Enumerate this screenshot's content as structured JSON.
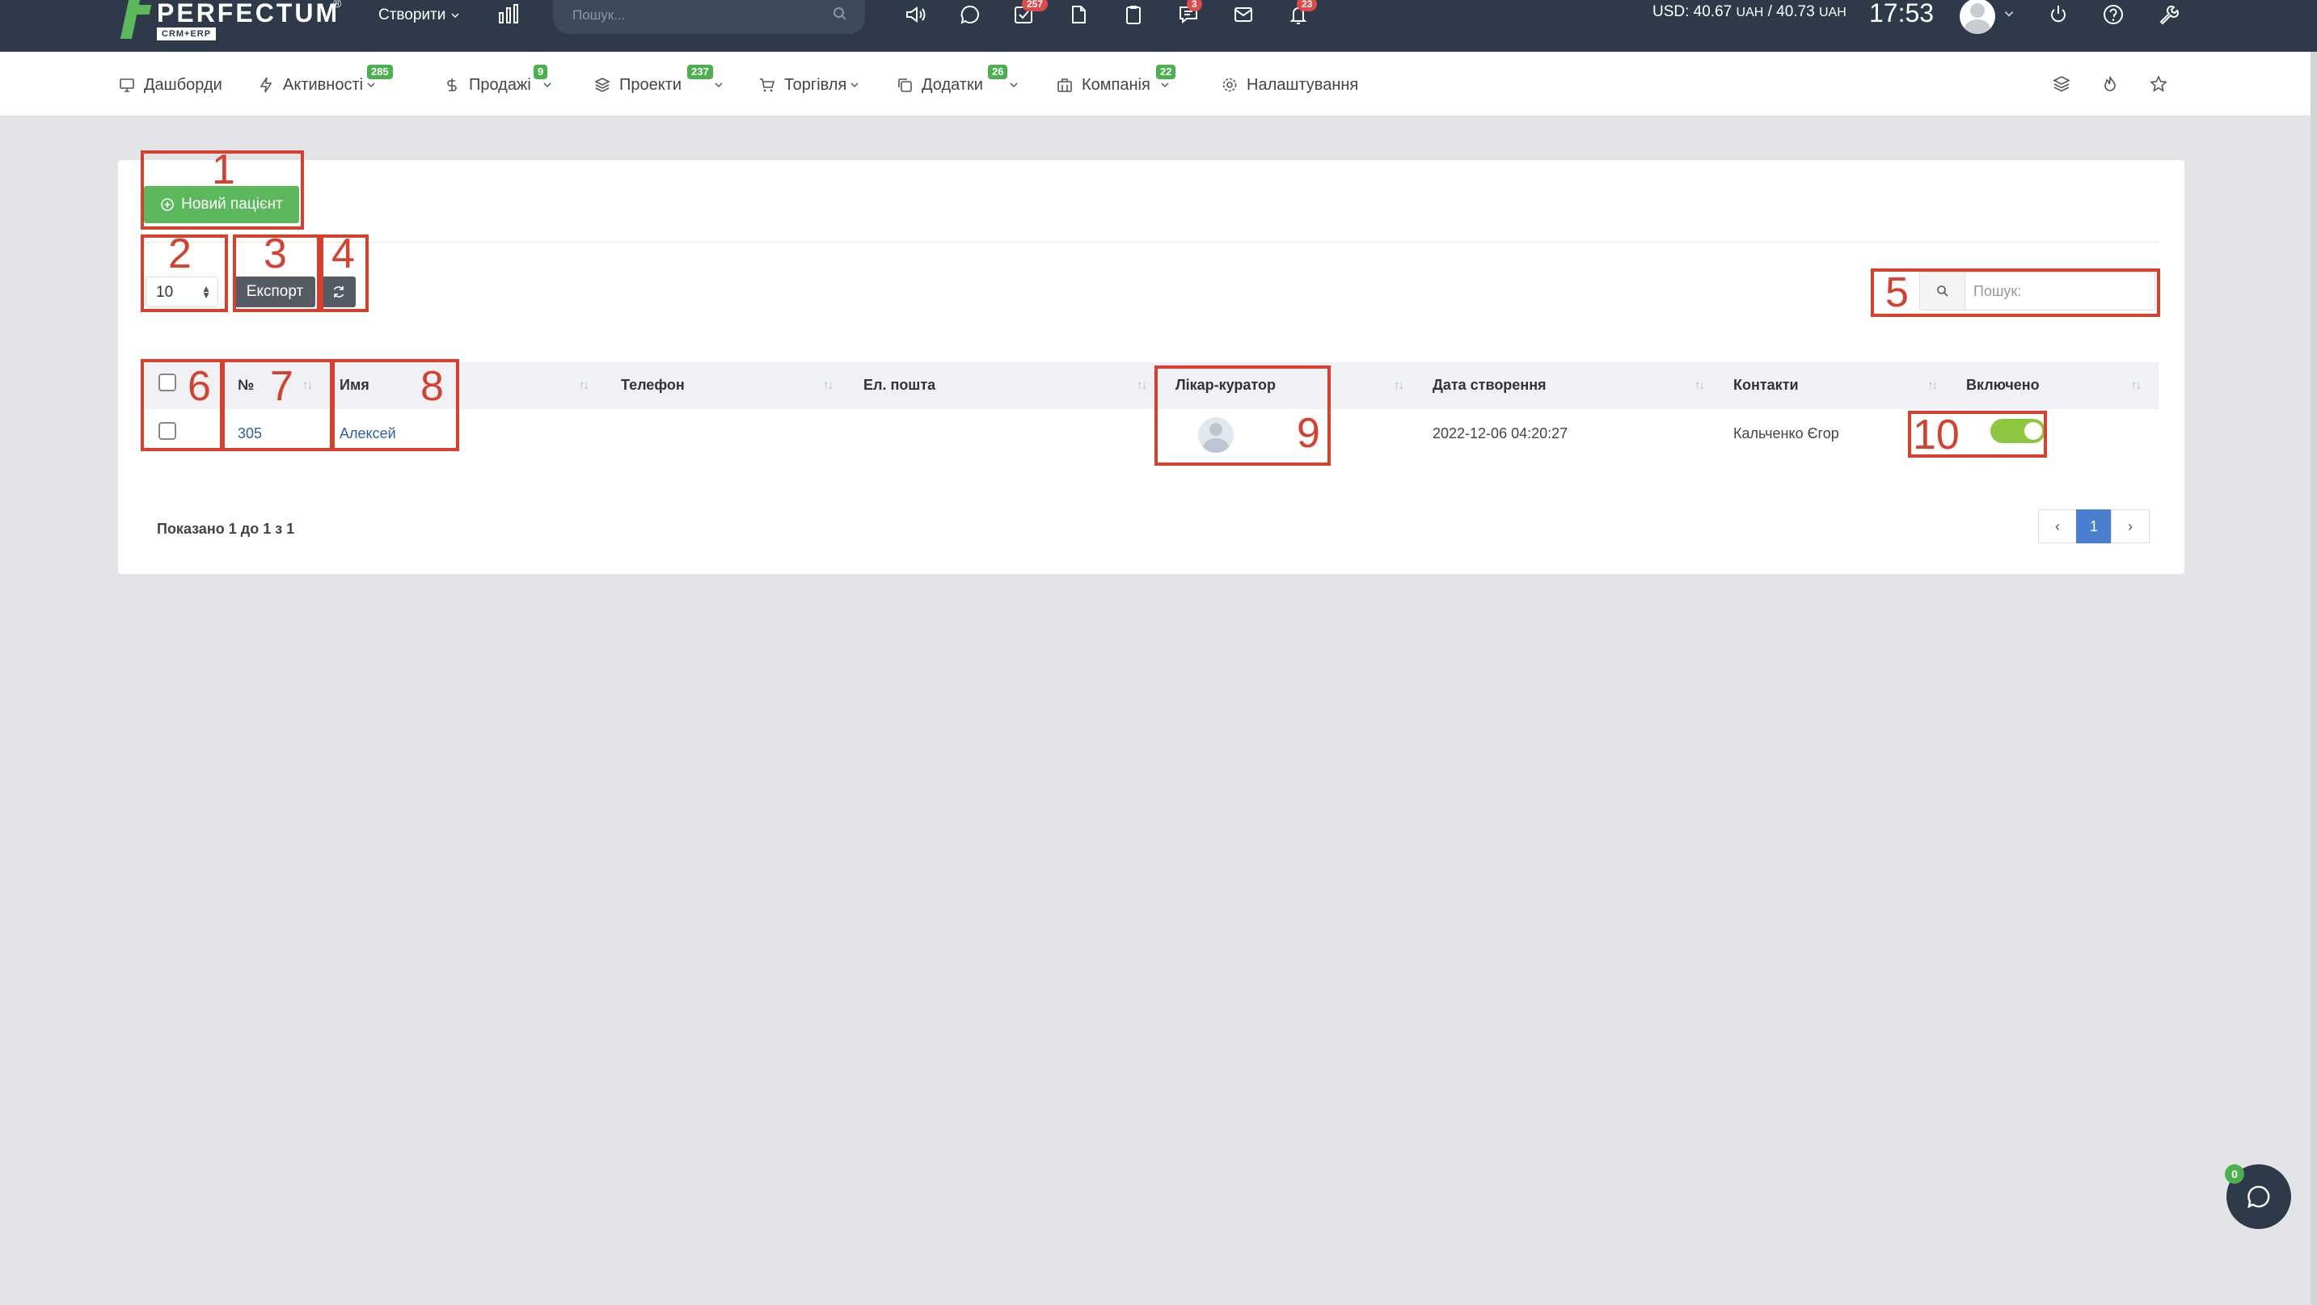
{
  "topbar": {
    "logo_name": "PERFECTUM",
    "logo_sub": "CRM+ERP",
    "logo_reg": "®",
    "create_label": "Створити",
    "search_placeholder": "Пошук...",
    "badges": {
      "tasks": "257",
      "messages": "3",
      "notifications": "23"
    },
    "rate_text": "USD: 40.67",
    "rate_cur1": "UAH",
    "rate_sep": " / 40.73",
    "rate_cur2": "UAH",
    "time": "17:53"
  },
  "nav": {
    "items": [
      {
        "label": "Дашборди",
        "icon": "monitor-icon"
      },
      {
        "label": "Активності",
        "badge": "285",
        "icon": "bolt-icon"
      },
      {
        "label": "Продажі",
        "badge": "9",
        "icon": "dollar-icon"
      },
      {
        "label": "Проекти",
        "badge": "237",
        "icon": "layers-icon"
      },
      {
        "label": "Торгівля",
        "icon": "cart-icon"
      },
      {
        "label": "Додатки",
        "badge": "26",
        "icon": "copy-icon"
      },
      {
        "label": "Компанія",
        "badge": "22",
        "icon": "building-icon"
      },
      {
        "label": "Налаштування",
        "icon": "gear-icon"
      }
    ]
  },
  "toolbar": {
    "new_patient_label": "Новий пацієнт",
    "page_length": "10",
    "export_label": "Експорт",
    "search_placeholder": "Пошук:"
  },
  "table": {
    "columns": [
      "№",
      "Имя",
      "Телефон",
      "Ел. пошта",
      "Лікар-куратор",
      "Дата створення",
      "Контакти",
      "Включено"
    ],
    "rows": [
      {
        "id": "305",
        "name": "Алексей",
        "phone": "",
        "email": "",
        "created": "2022-12-06 04:20:27",
        "contact": "Кальченко Єгор",
        "enabled": true
      }
    ]
  },
  "footer": {
    "info": "Показано 1 до 1 з 1",
    "prev": "‹",
    "page": "1",
    "next": "›"
  },
  "chat": {
    "badge": "0"
  },
  "annotations": [
    "1",
    "2",
    "3",
    "4",
    "5",
    "6",
    "7",
    "8",
    "9",
    "10"
  ],
  "colors": {
    "topbar": "#2e3a4a",
    "primary_green": "#5cb85c",
    "annotation": "#d6412f",
    "pager_active": "#4a7fd0"
  }
}
